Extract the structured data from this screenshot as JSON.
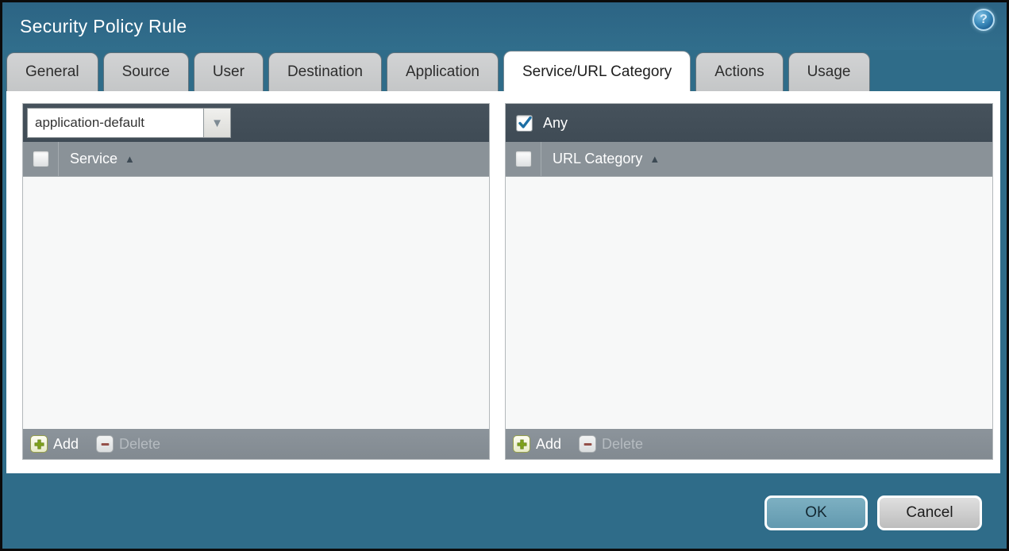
{
  "dialog": {
    "title": "Security Policy Rule",
    "help_glyph": "?"
  },
  "tabs": [
    {
      "label": "General",
      "active": false
    },
    {
      "label": "Source",
      "active": false
    },
    {
      "label": "User",
      "active": false
    },
    {
      "label": "Destination",
      "active": false
    },
    {
      "label": "Application",
      "active": false
    },
    {
      "label": "Service/URL Category",
      "active": true
    },
    {
      "label": "Actions",
      "active": false
    },
    {
      "label": "Usage",
      "active": false
    }
  ],
  "service_panel": {
    "dropdown": {
      "value": "application-default"
    },
    "select_all_checked": false,
    "column_header": "Service",
    "sort_icon": "▲",
    "rows": [],
    "add_label": "Add",
    "delete_label": "Delete",
    "delete_enabled": false
  },
  "url_category_panel": {
    "any_label": "Any",
    "any_checked": true,
    "select_all_checked": false,
    "column_header": "URL Category",
    "sort_icon": "▲",
    "rows": [],
    "add_label": "Add",
    "delete_label": "Delete",
    "delete_enabled": false
  },
  "buttons": {
    "ok": "OK",
    "cancel": "Cancel"
  },
  "icons": {
    "dropdown_arrow": "▼"
  },
  "colors": {
    "background_teal": "#2f6c89",
    "panel_bar_dark": "#414e58",
    "header_row_gray": "#8a9298",
    "footer_row_gray": "#878f96",
    "ok_button_blue": "#69a0b6",
    "cancel_button_gray": "#cecece",
    "add_icon_green": "#7da01c",
    "delete_icon_red": "#94514a",
    "check_blue": "#1d6fa5",
    "tab_gray": "#c9cbcc",
    "active_tab_white": "#ffffff"
  }
}
